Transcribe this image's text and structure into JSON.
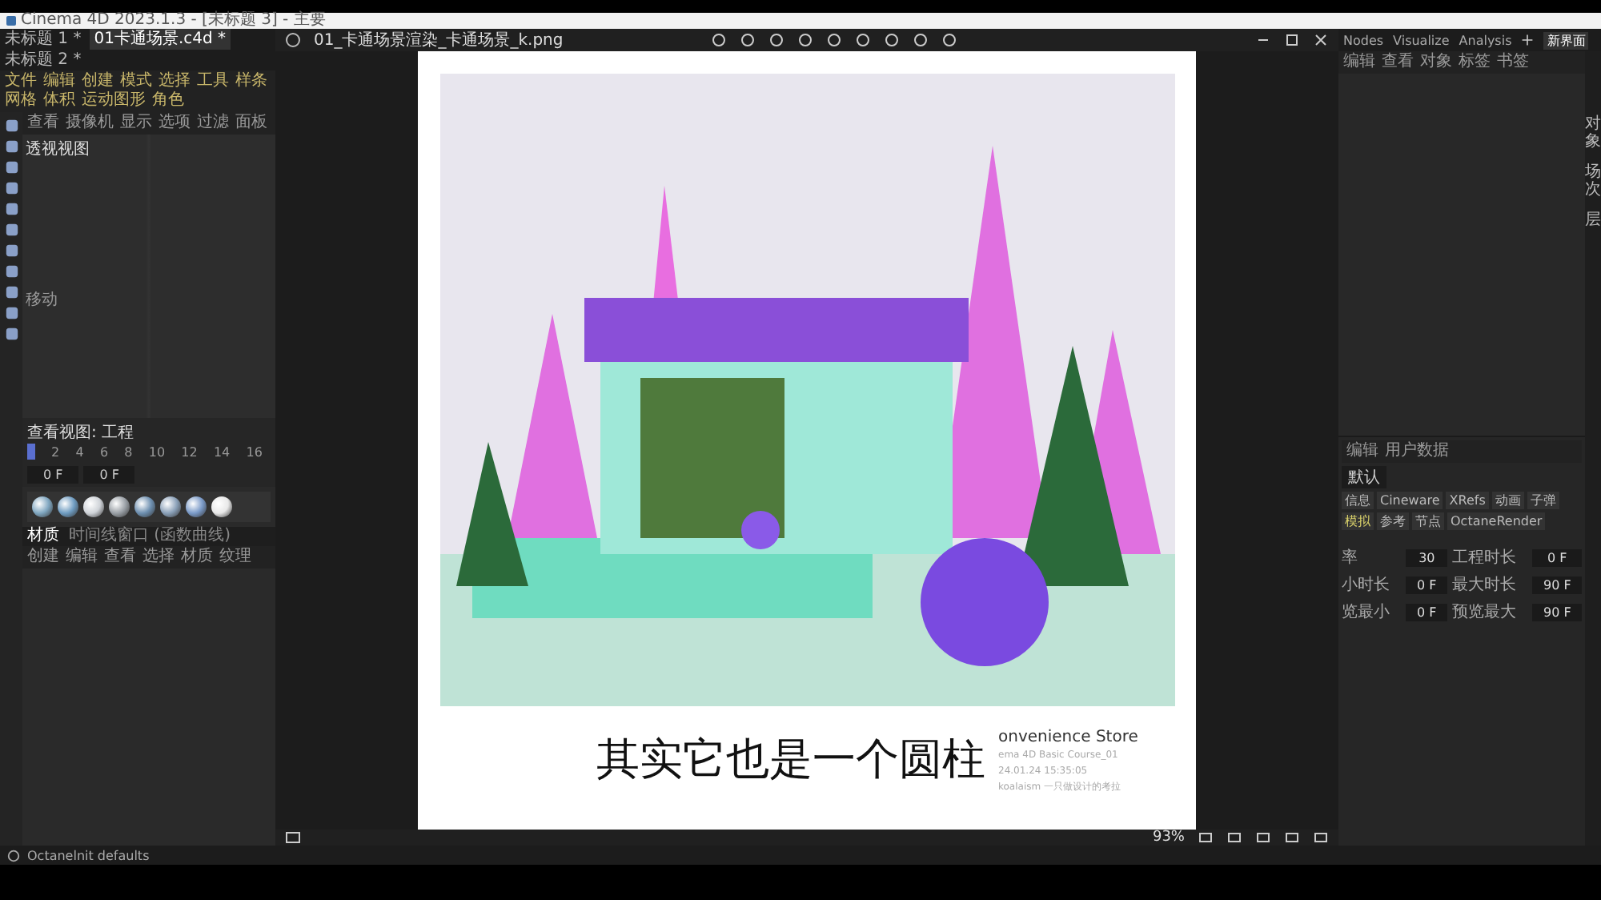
{
  "app": {
    "title": "Cinema 4D 2023.1.3 - [未标题 3] - 主要"
  },
  "doc_tabs": [
    {
      "label": "未标题 1 *",
      "selected": false
    },
    {
      "label": "01卡通场景.c4d *",
      "selected": true
    },
    {
      "label": "未标题 2 *",
      "selected": false
    }
  ],
  "menu": [
    "文件",
    "编辑",
    "创建",
    "模式",
    "选择",
    "工具",
    "样条",
    "网格",
    "体积",
    "运动图形",
    "角色"
  ],
  "viewport": {
    "menu": [
      "查看",
      "摄像机",
      "显示",
      "选项",
      "过滤",
      "面板"
    ],
    "label": "透视视图",
    "move_label": "移动"
  },
  "timeline": {
    "title": "查看视图: 工程",
    "ticks": [
      "2",
      "4",
      "6",
      "8",
      "10",
      "12",
      "14",
      "16"
    ],
    "level": 0.0,
    "start": "0 F",
    "end": "0 F"
  },
  "materials": {
    "tabs": [
      {
        "label": "材质",
        "selected": true
      },
      {
        "label": "时间线窗口 (函数曲线)",
        "selected": false
      }
    ],
    "menu": [
      "创建",
      "编辑",
      "查看",
      "选择",
      "材质",
      "纹理"
    ]
  },
  "viewer": {
    "file": "01_卡通场景渲染_卡通场景_k.png",
    "zoom": "93%",
    "caption": {
      "subtitle": "其实它也是一个圆柱",
      "heading": "onvenience Store",
      "course": "ema 4D Basic Course_01",
      "stamp": "24.01.24   15:35:05",
      "author": "koalaism 一只做设计的考拉"
    }
  },
  "right": {
    "tabs": [
      "Nodes",
      "Visualize",
      "Analysis"
    ],
    "layout": "新界面",
    "object_menu": [
      "编辑",
      "查看",
      "对象",
      "标签",
      "书签"
    ],
    "attr_menu": [
      "编辑",
      "用户数据"
    ],
    "preset": "默认",
    "attr_tabs": [
      {
        "label": "信息",
        "selected": false
      },
      {
        "label": "Cineware",
        "selected": false
      },
      {
        "label": "XRefs",
        "selected": false
      },
      {
        "label": "动画",
        "selected": false
      },
      {
        "label": "子弹",
        "selected": false
      },
      {
        "label": "模拟",
        "selected": true
      },
      {
        "label": "参考",
        "selected": false
      },
      {
        "label": "节点",
        "selected": false
      },
      {
        "label": "OctaneRender",
        "selected": false
      }
    ],
    "fields": [
      {
        "label": "率",
        "value": "30"
      },
      {
        "label": "工程时长",
        "value": "0 F"
      },
      {
        "label": "小时长",
        "value": "0 F"
      },
      {
        "label": "最大时长",
        "value": "90 F"
      },
      {
        "label": "览最小",
        "value": "0 F"
      },
      {
        "label": "预览最大",
        "value": "90 F"
      }
    ],
    "side_tabs": [
      "对象",
      "场次",
      "层"
    ]
  },
  "status": "Octanelnit defaults"
}
